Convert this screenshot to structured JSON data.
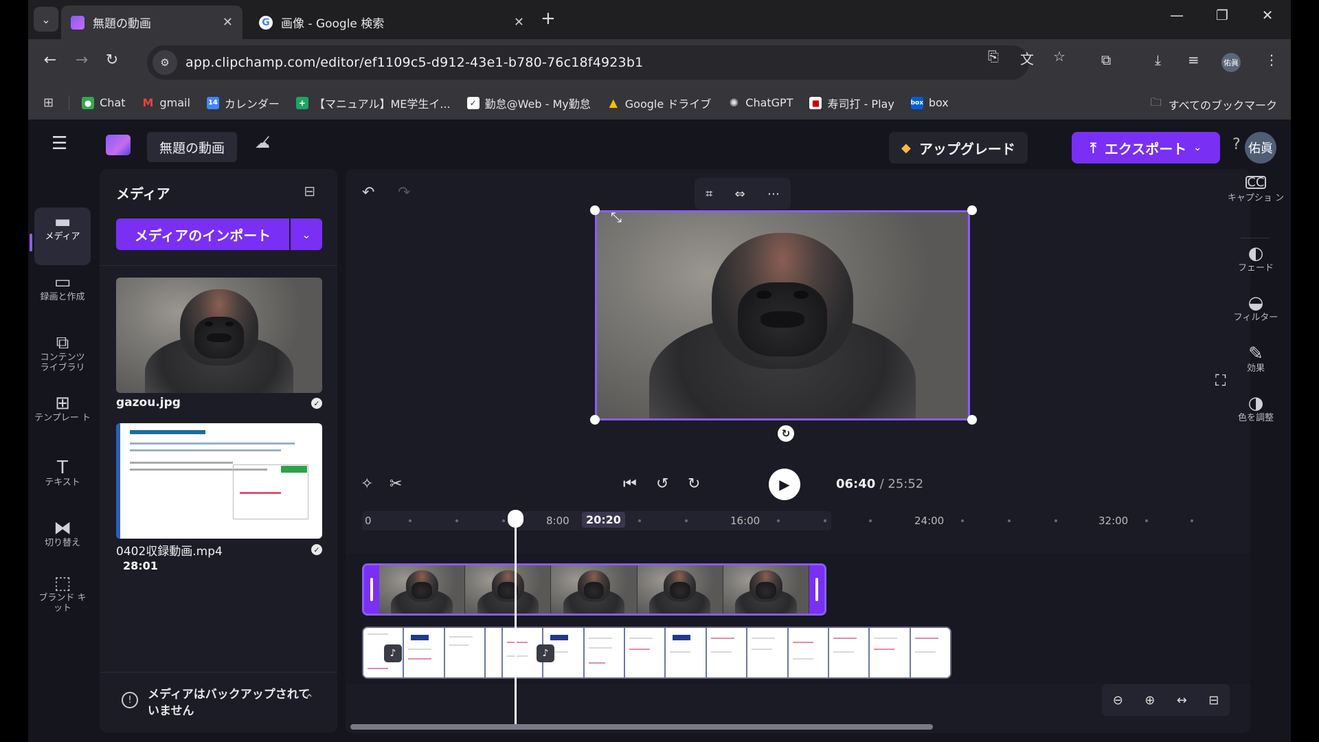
{
  "browser": {
    "tabs": [
      {
        "title": "無題の動画",
        "active": true
      },
      {
        "title": "画像 - Google 検索",
        "active": false
      }
    ],
    "url": "app.clipchamp.com/editor/ef1109c5-d912-43e1-b780-76c18f4923b1",
    "profile_chip": "佑眞",
    "bookmarks": [
      {
        "label": "Chat",
        "icon": "google-chat-icon"
      },
      {
        "label": "gmail",
        "icon": "gmail-icon"
      },
      {
        "label": "カレンダー",
        "icon": "calendar-icon"
      },
      {
        "label": "【マニュアル】ME学生イ...",
        "icon": "manual-icon"
      },
      {
        "label": "勤怠@Web - My勤怠",
        "icon": "attendance-icon"
      },
      {
        "label": "Google ドライブ",
        "icon": "drive-icon"
      },
      {
        "label": "ChatGPT",
        "icon": "chatgpt-icon"
      },
      {
        "label": "寿司打 - Play",
        "icon": "sushida-icon"
      },
      {
        "label": "box",
        "icon": "box-icon"
      }
    ],
    "all_bookmarks": "すべてのブックマーク"
  },
  "app": {
    "project_title": "無題の動画",
    "upgrade_label": "アップグレード",
    "export_label": "エクスポート",
    "avatar": "佑眞",
    "accent": "#7a2ff5",
    "left_nav": [
      {
        "label": "メディア",
        "icon": "folder-icon"
      },
      {
        "label": "録画と作成",
        "icon": "camera-icon"
      },
      {
        "label": "コンテンツ ライブラリ",
        "icon": "library-icon"
      },
      {
        "label": "テンプレー ト",
        "icon": "template-icon"
      },
      {
        "label": "テキスト",
        "icon": "text-icon"
      },
      {
        "label": "切り替え",
        "icon": "transition-icon"
      },
      {
        "label": "ブランド キット",
        "icon": "brand-kit-icon"
      }
    ],
    "right_nav": [
      {
        "label": "キャプショ ン",
        "icon": "cc-icon"
      },
      {
        "label": "フェード",
        "icon": "fade-icon"
      },
      {
        "label": "フィルター",
        "icon": "filter-icon"
      },
      {
        "label": "効果",
        "icon": "magic-wand-icon"
      },
      {
        "label": "色を調整",
        "icon": "color-adjust-icon"
      }
    ]
  },
  "media_panel": {
    "title": "メディア",
    "import_label": "メディアのインポート",
    "items": [
      {
        "filename": "gazou.jpg",
        "type": "image"
      },
      {
        "filename": "0402収録動画.mp4",
        "type": "video",
        "duration": "28:01"
      }
    ],
    "backup_notice": "メディアはバックアップされていません"
  },
  "player": {
    "current_time": "06:40",
    "total_time": "/ 25:52"
  },
  "timeline": {
    "ruler_labels": [
      "0",
      "8:00",
      "20:20",
      "16:00",
      "24:00",
      "32:00"
    ],
    "hovered_time": "20:20"
  }
}
